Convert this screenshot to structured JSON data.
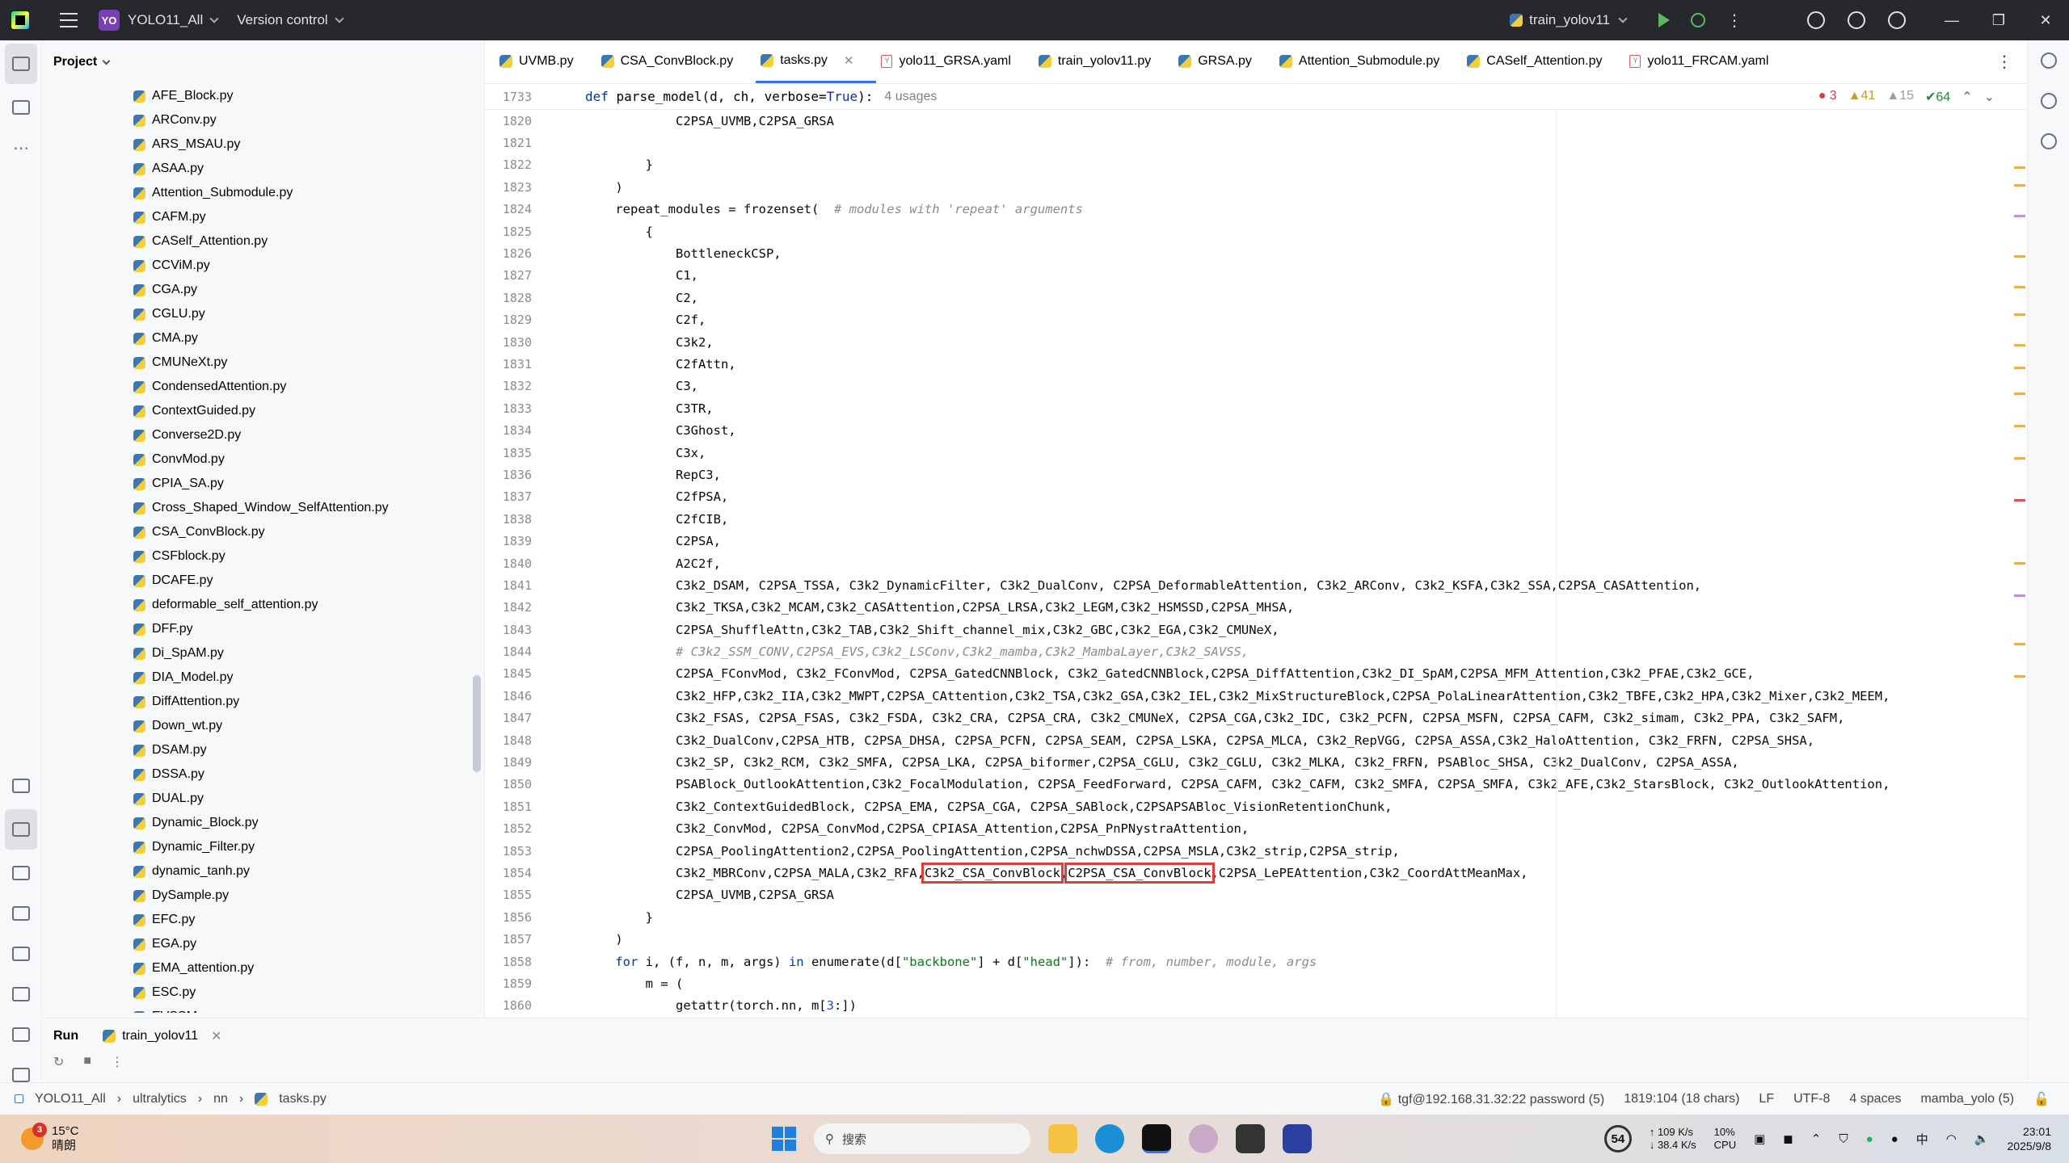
{
  "titlebar": {
    "project_badge": "YO",
    "project_name": "YOLO11_All",
    "version_control": "Version control",
    "run_config": "train_yolov11"
  },
  "project_panel": {
    "title": "Project",
    "files": [
      "AFE_Block.py",
      "ARConv.py",
      "ARS_MSAU.py",
      "ASAA.py",
      "Attention_Submodule.py",
      "CAFM.py",
      "CASelf_Attention.py",
      "CCViM.py",
      "CGA.py",
      "CGLU.py",
      "CMA.py",
      "CMUNeXt.py",
      "CondensedAttention.py",
      "ContextGuided.py",
      "Converse2D.py",
      "ConvMod.py",
      "CPIA_SA.py",
      "Cross_Shaped_Window_SelfAttention.py",
      "CSA_ConvBlock.py",
      "CSFblock.py",
      "DCAFE.py",
      "deformable_self_attention.py",
      "DFF.py",
      "Di_SpAM.py",
      "DIA_Model.py",
      "DiffAttention.py",
      "Down_wt.py",
      "DSAM.py",
      "DSSA.py",
      "DUAL.py",
      "Dynamic_Block.py",
      "Dynamic_Filter.py",
      "dynamic_tanh.py",
      "DySample.py",
      "EFC.py",
      "EGA.py",
      "EMA_attention.py",
      "ESC.py",
      "EVSSM.py"
    ]
  },
  "tabs": [
    {
      "label": "UVMB.py",
      "type": "py"
    },
    {
      "label": "CSA_ConvBlock.py",
      "type": "py"
    },
    {
      "label": "tasks.py",
      "type": "py",
      "active": true
    },
    {
      "label": "yolo11_GRSA.yaml",
      "type": "yaml"
    },
    {
      "label": "train_yolov11.py",
      "type": "py"
    },
    {
      "label": "GRSA.py",
      "type": "py"
    },
    {
      "label": "Attention_Submodule.py",
      "type": "py"
    },
    {
      "label": "CASelf_Attention.py",
      "type": "py"
    },
    {
      "label": "yolo11_FRCAM.yaml",
      "type": "yaml"
    }
  ],
  "sticky": {
    "line": "1733",
    "def_kw": "def",
    "fn": " parse_model(d, ch, verbose=",
    "true_kw": "True",
    "tail": "):",
    "usages": "4 usages"
  },
  "inspections": {
    "errors": "3",
    "warnings": "41",
    "weak": "15",
    "ok": "64"
  },
  "code_lines": [
    {
      "n": "1820",
      "t": "            C2PSA_UVMB,C2PSA_GRSA"
    },
    {
      "n": "1821",
      "t": ""
    },
    {
      "n": "1822",
      "t": "        }"
    },
    {
      "n": "1823",
      "t": "    )"
    },
    {
      "n": "1824",
      "t": "    repeat_modules = frozenset(  ",
      "c": "# modules with 'repeat' arguments"
    },
    {
      "n": "1825",
      "t": "        {"
    },
    {
      "n": "1826",
      "t": "            BottleneckCSP,"
    },
    {
      "n": "1827",
      "t": "            C1,"
    },
    {
      "n": "1828",
      "t": "            C2,"
    },
    {
      "n": "1829",
      "t": "            C2f,"
    },
    {
      "n": "1830",
      "t": "            C3k2,"
    },
    {
      "n": "1831",
      "t": "            C2fAttn,"
    },
    {
      "n": "1832",
      "t": "            C3,"
    },
    {
      "n": "1833",
      "t": "            C3TR,"
    },
    {
      "n": "1834",
      "t": "            C3Ghost,"
    },
    {
      "n": "1835",
      "t": "            C3x,"
    },
    {
      "n": "1836",
      "t": "            RepC3,"
    },
    {
      "n": "1837",
      "t": "            C2fPSA,"
    },
    {
      "n": "1838",
      "t": "            C2fCIB,"
    },
    {
      "n": "1839",
      "t": "            C2PSA,"
    },
    {
      "n": "1840",
      "t": "            A2C2f,"
    },
    {
      "n": "1841",
      "t": "            C3k2_DSAM, C2PSA_TSSA, C3k2_DynamicFilter, C3k2_DualConv, C2PSA_DeformableAttention, C3k2_ARConv, C3k2_KSFA,C3k2_SSA,C2PSA_CASAttention,"
    },
    {
      "n": "1842",
      "t": "            C3k2_TKSA,C3k2_MCAM,C3k2_CASAttention,C2PSA_LRSA,C3k2_LEGM,C3k2_HSMSSD,C2PSA_MHSA,"
    },
    {
      "n": "1843",
      "t": "            C2PSA_ShuffleAttn,C3k2_TAB,C3k2_Shift_channel_mix,C3k2_GBC,C3k2_EGA,C3k2_CMUNeX,"
    },
    {
      "n": "1844",
      "t": "            ",
      "c": "# C3k2_SSM_CONV,C2PSA_EVS,C3k2_LSConv,C3k2_mamba,C3k2_MambaLayer,C3k2_SAVSS,"
    },
    {
      "n": "1845",
      "t": "            C2PSA_FConvMod, C3k2_FConvMod, C2PSA_GatedCNNBlock, C3k2_GatedCNNBlock,C2PSA_DiffAttention,C3k2_DI_SpAM,C2PSA_MFM_Attention,C3k2_PFAE,C3k2_GCE,"
    },
    {
      "n": "1846",
      "t": "            C3k2_HFP,C3k2_IIA,C3k2_MWPT,C2PSA_CAttention,C3k2_TSA,C3k2_GSA,C3k2_IEL,C3k2_MixStructureBlock,C2PSA_PolaLinearAttention,C3k2_TBFE,C3k2_HPA,C3k2_Mixer,C3k2_MEEM,"
    },
    {
      "n": "1847",
      "t": "            C3k2_FSAS, C2PSA_FSAS, C3k2_FSDA, C3k2_CRA, C2PSA_CRA, C3k2_CMUNeX, C2PSA_CGA,C3k2_IDC, C3k2_PCFN, C2PSA_MSFN, C2PSA_CAFM, C3k2_simam, C3k2_PPA, C3k2_SAFM,"
    },
    {
      "n": "1848",
      "t": "            C3k2_DualConv,C2PSA_HTB, C2PSA_DHSA, C2PSA_PCFN, C2PSA_SEAM, C2PSA_LSKA, C2PSA_MLCA, C3k2_RepVGG, C2PSA_ASSA,C3k2_HaloAttention, C3k2_FRFN, C2PSA_SHSA,"
    },
    {
      "n": "1849",
      "t": "            C3k2_SP, C3k2_RCM, C3k2_SMFA, C2PSA_LKA, C2PSA_biformer,C2PSA_CGLU, C3k2_CGLU, C3k2_MLKA, C3k2_FRFN, PSABloc_SHSA, C3k2_DualConv, C2PSA_ASSA,"
    },
    {
      "n": "1850",
      "t": "            PSABlock_OutlookAttention,C3k2_FocalModulation, C2PSA_FeedForward, C2PSA_CAFM, C3k2_CAFM, C3k2_SMFA, C2PSA_SMFA, C3k2_AFE,C3k2_StarsBlock, C3k2_OutlookAttention,"
    },
    {
      "n": "1851",
      "t": "            C3k2_ContextGuidedBlock, C2PSA_EMA, C2PSA_CGA, C2PSA_SABlock,C2PSAPSABloc_VisionRetentionChunk,"
    },
    {
      "n": "1852",
      "t": "            C3k2_ConvMod, C2PSA_ConvMod,C2PSA_CPIASA_Attention,C2PSA_PnPNystraAttention,"
    },
    {
      "n": "1853",
      "t": "            C2PSA_PoolingAttention2,C2PSA_PoolingAttention,C2PSA_nchwDSSA,C2PSA_MSLA,C3k2_strip,C2PSA_strip,"
    },
    {
      "n": "1854",
      "t": "            C3k2_MBRConv,C2PSA_MALA,C3k2_RFA,",
      "h1": "C3k2_CSA_ConvBlock",
      "mid": ",",
      "h2": "C2PSA_CSA_ConvBlock",
      "t2": ",C2PSA_LePEAttention,C3k2_CoordAttMeanMax,"
    },
    {
      "n": "1855",
      "t": "            C2PSA_UVMB,C2PSA_GRSA"
    },
    {
      "n": "1856",
      "t": "        }"
    },
    {
      "n": "1857",
      "t": "    )"
    },
    {
      "n": "1858",
      "for": true,
      "t": "    for i, (f, n, m, args) in enumerate(d[\"backbone\"] + d[\"head\"]):  ",
      "c": "# from, number, module, args"
    },
    {
      "n": "1859",
      "t": "        m = ("
    },
    {
      "n": "1860",
      "t": "            getattr(torch.nn, m[3:])"
    }
  ],
  "run_panel": {
    "title": "Run",
    "tab": "train_yolov11"
  },
  "statusbar": {
    "crumbs": [
      "YOLO11_All",
      "ultralytics",
      "nn",
      "tasks.py"
    ],
    "remote": "tgf@192.168.31.32:22 password (5)",
    "position": "1819:104 (18 chars)",
    "line_sep": "LF",
    "encoding": "UTF-8",
    "indent": "4 spaces",
    "interpreter": "mamba_yolo (5)"
  },
  "taskbar": {
    "weather_badge": "3",
    "temp": "15°C",
    "weather": "晴朗",
    "search": "搜索",
    "cpu_badge": "54",
    "net_up": "↑ 109 K/s",
    "net_down": "↓ 38.4 K/s",
    "cpu_pct": "10%",
    "cpu_label": "CPU",
    "ime": "中",
    "time": "23:01",
    "date": "2025/9/8"
  }
}
